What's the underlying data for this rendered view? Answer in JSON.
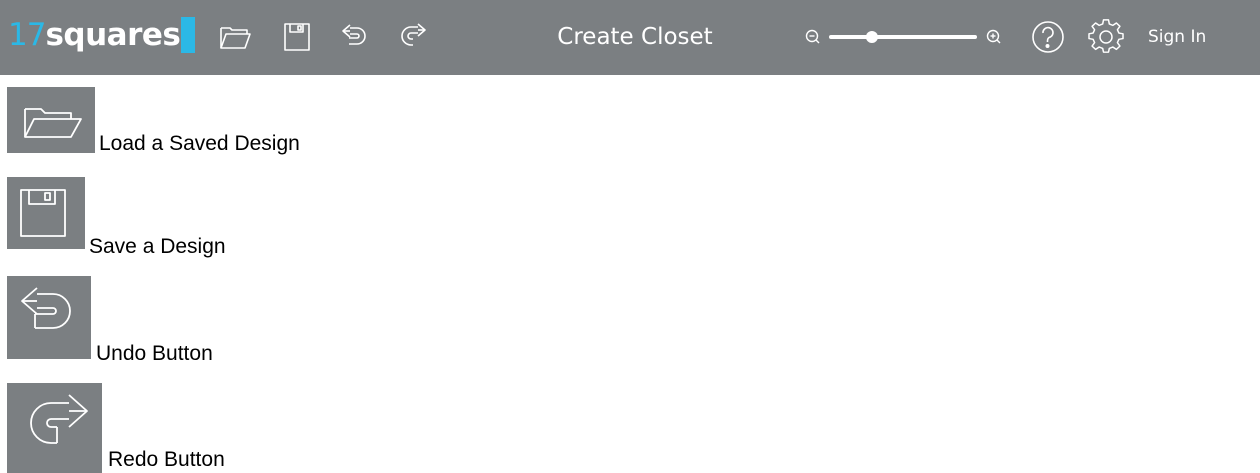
{
  "topbar": {
    "logo_number": "17",
    "logo_word": "squares",
    "title": "Create Closet",
    "sign_in": "Sign In",
    "icons": {
      "open": "folder-open-icon",
      "save": "floppy-disk-icon",
      "undo": "undo-icon",
      "redo": "redo-icon",
      "zoom_out": "zoom-out-icon",
      "zoom_in": "zoom-in-icon",
      "help": "question-mark-icon",
      "settings": "gear-icon"
    },
    "zoom_level": 0.29
  },
  "legend": [
    {
      "icon": "folder-open-icon",
      "label": "Load a Saved Design"
    },
    {
      "icon": "floppy-disk-icon",
      "label": "Save a Design"
    },
    {
      "icon": "undo-icon",
      "label": "Undo Button"
    },
    {
      "icon": "redo-icon",
      "label": "Redo Button"
    }
  ],
  "colors": {
    "toolbar_bg": "#7b7f82",
    "brand_accent": "#2bb8e6",
    "icon_stroke": "#ffffff",
    "text": "#000000"
  }
}
